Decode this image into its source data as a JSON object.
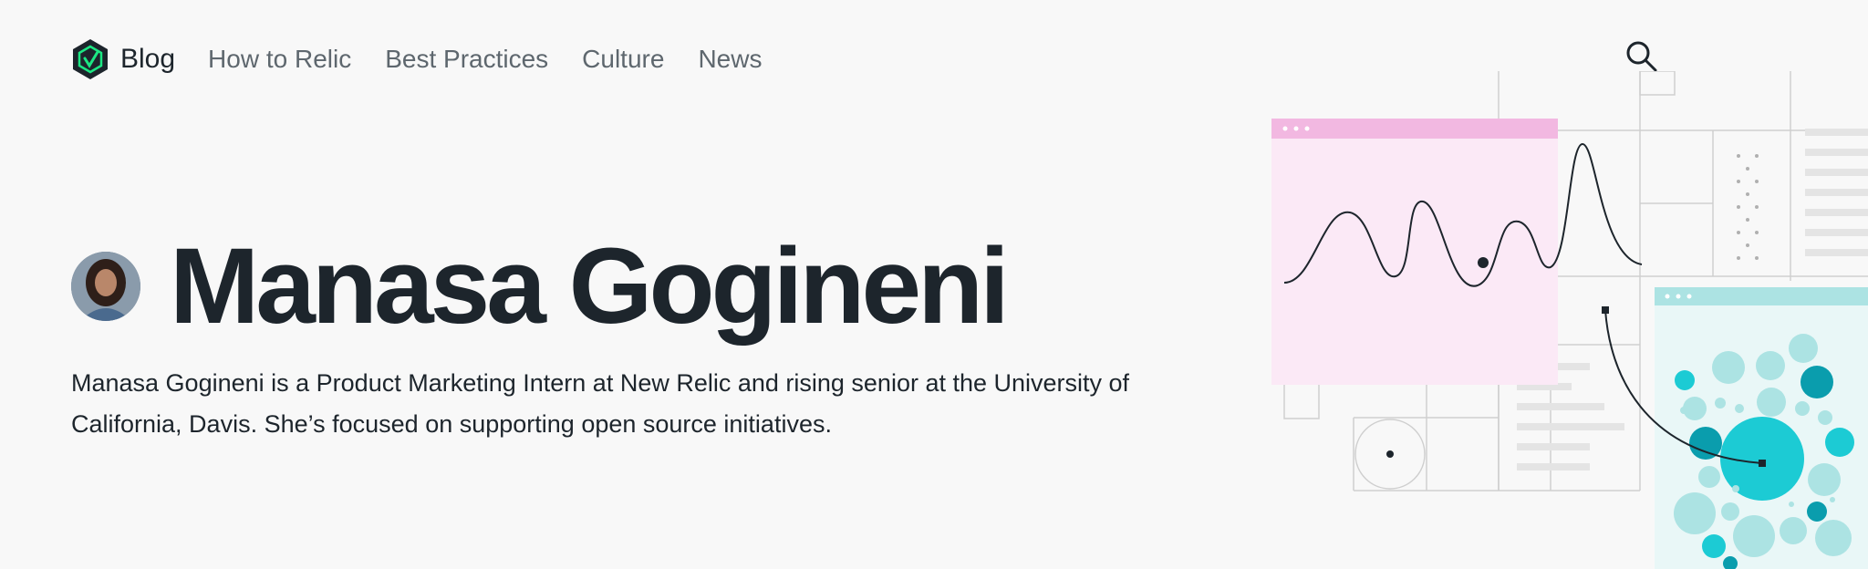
{
  "header": {
    "logo_label": "Blog",
    "nav": [
      {
        "label": "How to Relic"
      },
      {
        "label": "Best Practices"
      },
      {
        "label": "Culture"
      },
      {
        "label": "News"
      }
    ],
    "search_icon": "search-icon"
  },
  "author": {
    "name": "Manasa Gogineni",
    "bio": "Manasa Gogineni is a Product Marketing Intern at New Relic and rising senior at the University of California, Davis. She’s focused on supporting open source initiatives."
  },
  "colors": {
    "brand_green": "#1ce783",
    "dark": "#1d252c",
    "pink": "#f2b8e1",
    "teal": "#1ccbd4"
  }
}
